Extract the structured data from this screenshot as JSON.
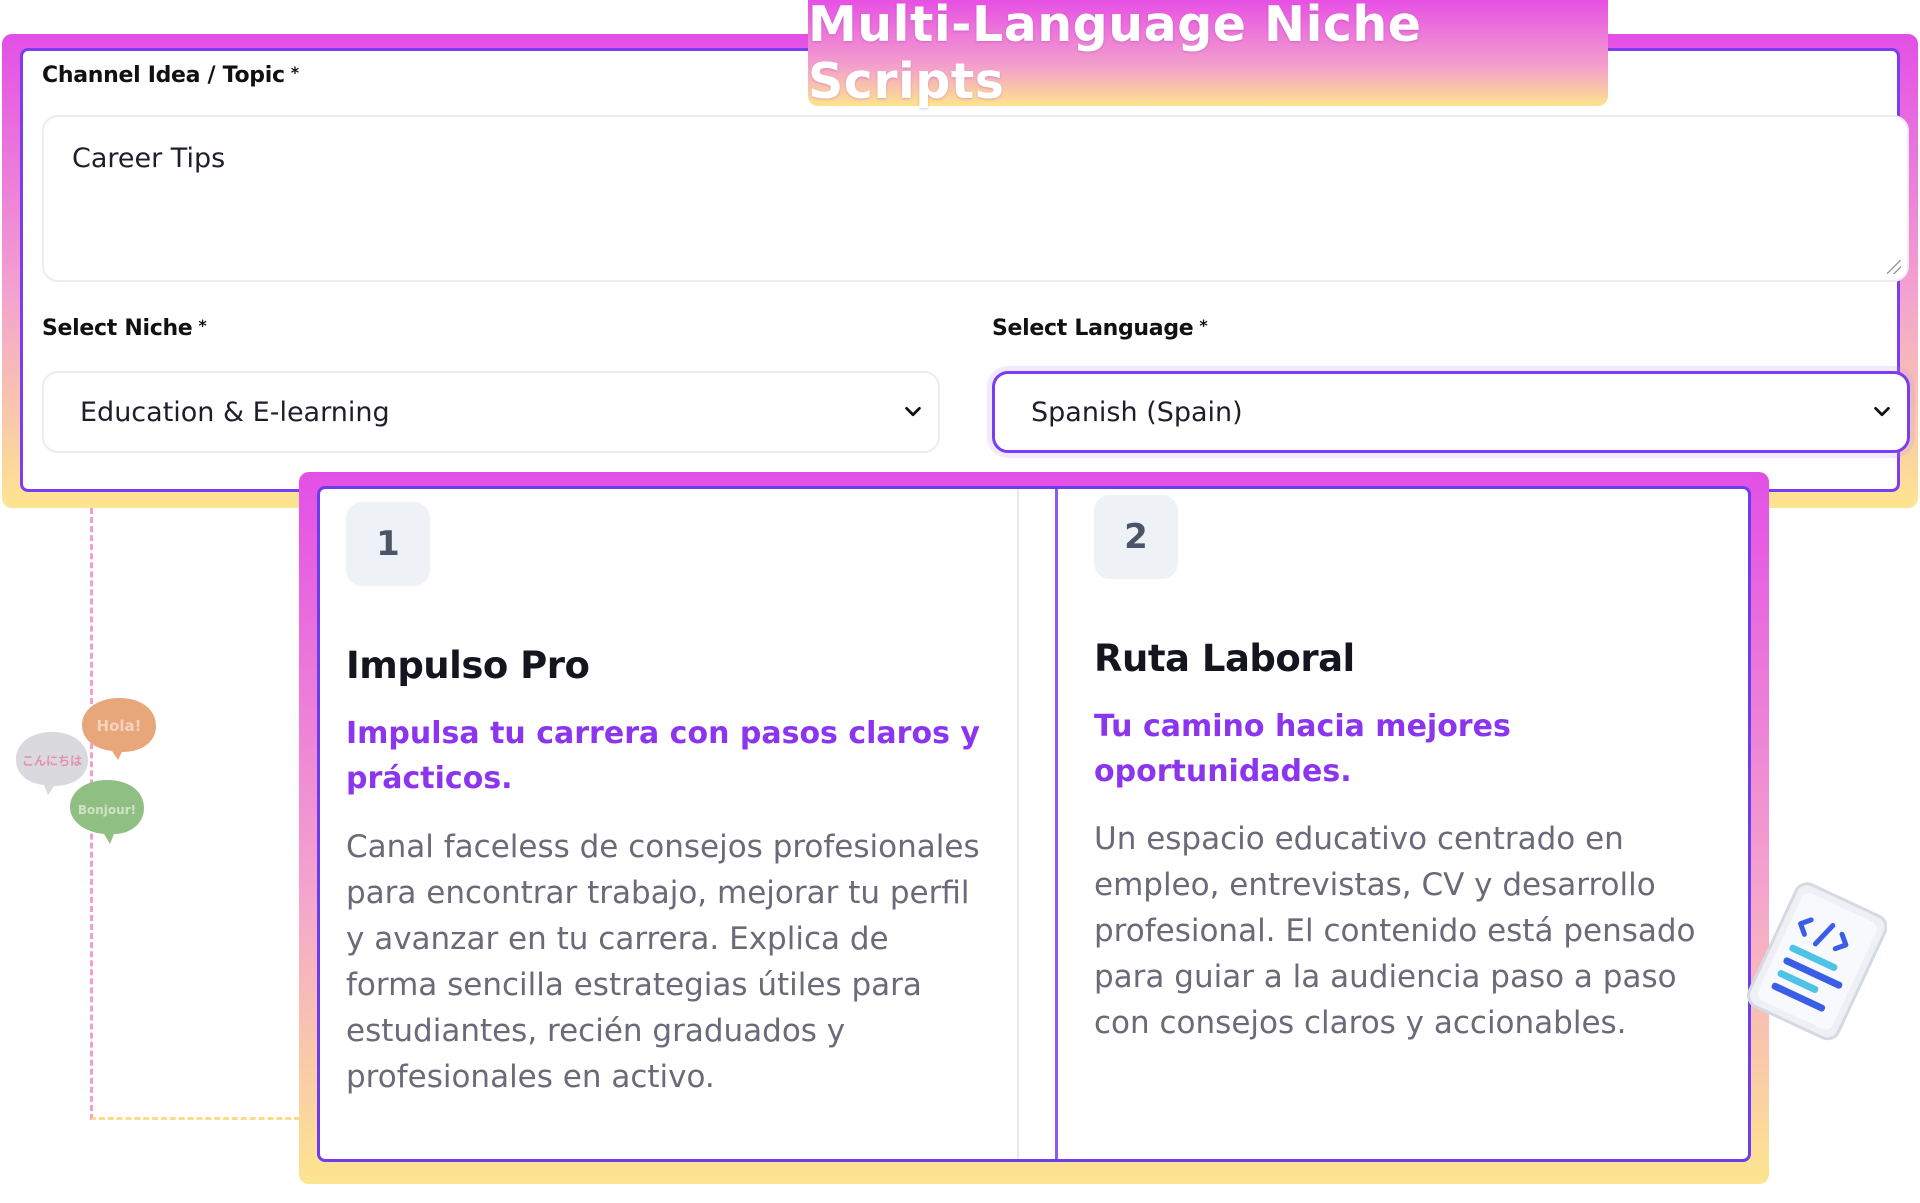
{
  "banner": {
    "title": "Multi-Language Niche Scripts"
  },
  "form": {
    "topic": {
      "label": "Channel Idea / Topic",
      "required_mark": "*",
      "value": "Career Tips"
    },
    "niche": {
      "label": "Select Niche",
      "required_mark": "*",
      "selected": "Education & E-learning"
    },
    "language": {
      "label": "Select Language",
      "required_mark": "*",
      "selected": "Spanish (Spain)"
    }
  },
  "scripts": [
    {
      "number": "1",
      "title": "Impulso Pro",
      "tagline": "Impulsa tu carrera con pasos claros y prácticos.",
      "description": "Canal faceless de consejos profesionales para encontrar trabajo, mejorar tu perfil y avanzar en tu carrera. Explica de forma sencilla estrategias útiles para estudiantes, recién graduados y profesionales en activo."
    },
    {
      "number": "2",
      "title": "Ruta Laboral",
      "tagline": "Tu camino hacia mejores oportunidades.",
      "description": "Un espacio educativo centrado en empleo, entrevistas, CV y desarrollo profesional. El contenido está pensado para guiar a la audiencia paso a paso con consejos claros y accionables."
    }
  ],
  "decorations": {
    "speech_bubbles": [
      "Hola!",
      "こんにちは",
      "Bonjour!"
    ],
    "colors": {
      "accent_purple": "#7a3df0",
      "tagline_purple": "#8b35ee",
      "gradient_pink": "#e34fe6",
      "gradient_yellow": "#fde58f"
    }
  }
}
